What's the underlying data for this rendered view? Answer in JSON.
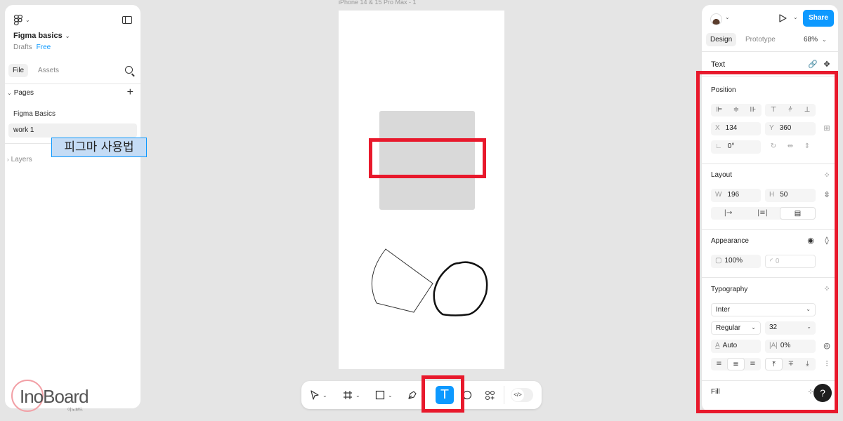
{
  "left_panel": {
    "file_name": "Figma basics",
    "drafts_label": "Drafts",
    "plan_badge": "Free",
    "tabs": {
      "file": "File",
      "assets": "Assets"
    },
    "pages_label": "Pages",
    "pages": [
      "Figma Basics",
      "work 1"
    ],
    "active_page": "work 1",
    "layers_label": "Layers"
  },
  "watermark": {
    "brand": "InoBoard",
    "sub": "이노보드"
  },
  "canvas": {
    "frame_label": "iPhone 14 & 15 Pro Max - 1",
    "selected_text": "피그마 사용법"
  },
  "toolbar": {
    "active_tool": "text",
    "text_tool_glyph": "T",
    "dev_mode_glyph": "</>"
  },
  "right_panel": {
    "share_label": "Share",
    "tabs": {
      "design": "Design",
      "prototype": "Prototype"
    },
    "zoom": "68%",
    "layer_type": "Text",
    "position": {
      "title": "Position",
      "x_label": "X",
      "x": "134",
      "y_label": "Y",
      "y": "360",
      "rotation": "0°"
    },
    "layout": {
      "title": "Layout",
      "w_label": "W",
      "w": "196",
      "h_label": "H",
      "h": "50"
    },
    "appearance": {
      "title": "Appearance",
      "opacity": "100%",
      "radius": "0"
    },
    "typography": {
      "title": "Typography",
      "font_family": "Inter",
      "font_weight": "Regular",
      "font_size": "32",
      "line_height": "Auto",
      "letter_spacing": "0%"
    },
    "fill": {
      "title": "Fill"
    },
    "help": "?"
  },
  "colors": {
    "accent": "#0d99ff",
    "highlight": "#e8192c",
    "selection_fill": "#c5dcf5"
  }
}
